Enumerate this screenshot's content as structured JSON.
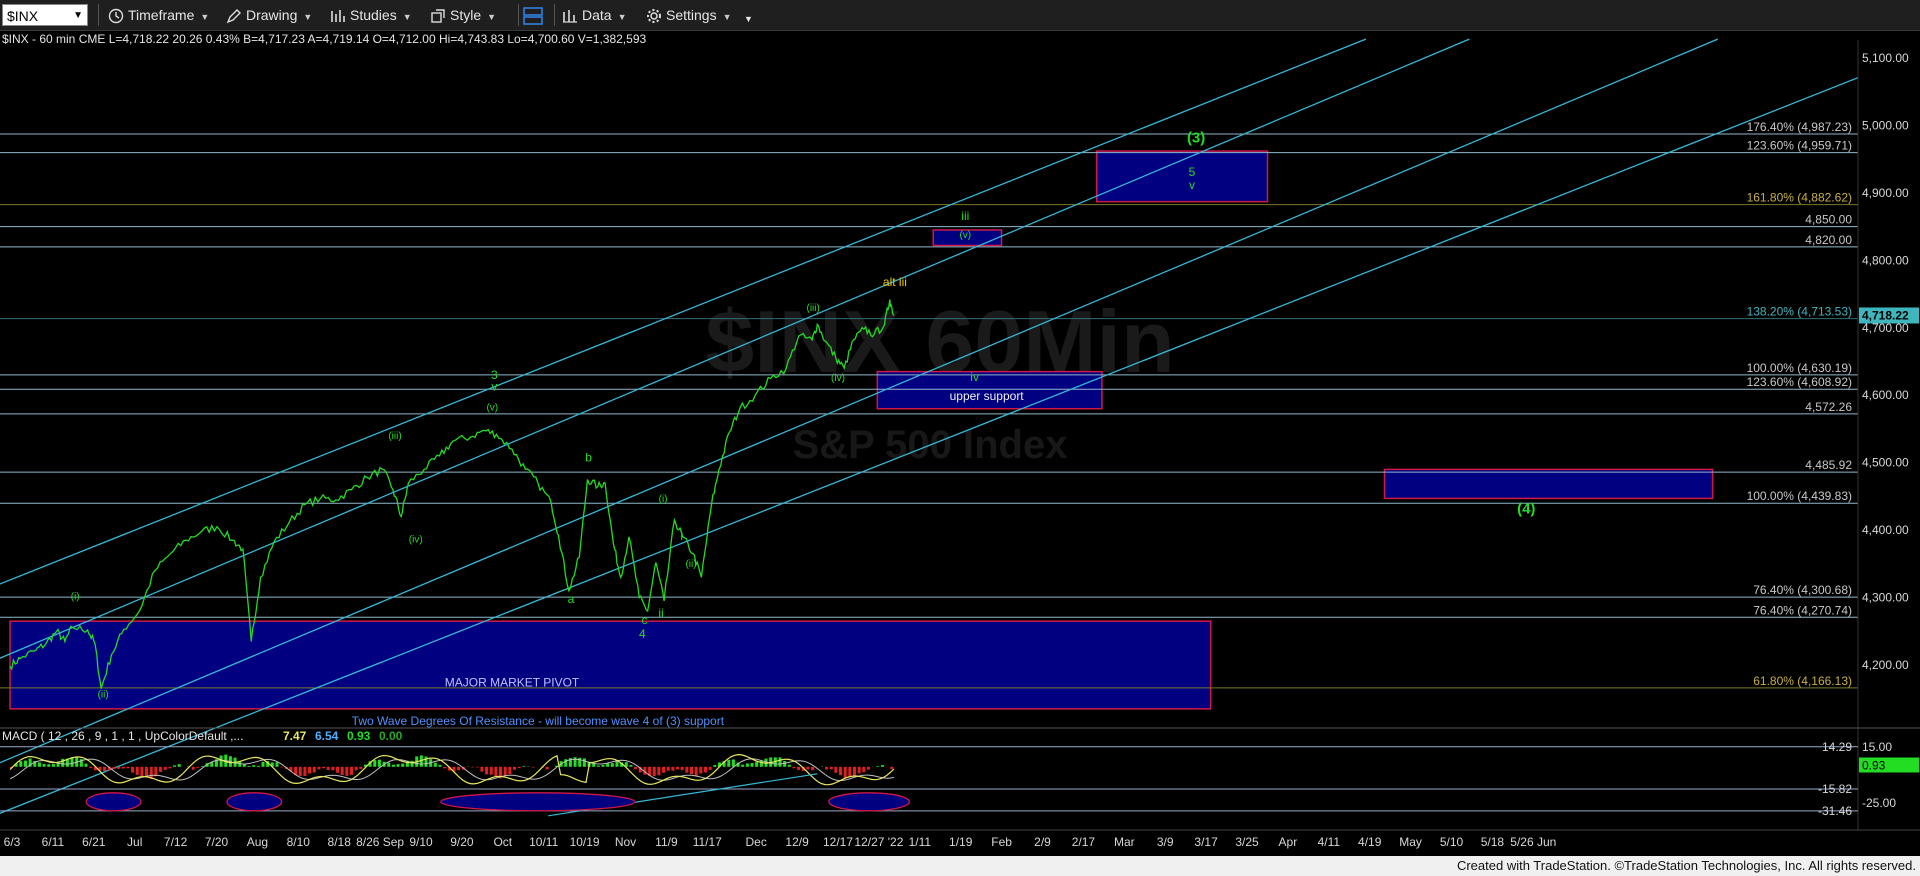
{
  "toolbar": {
    "symbol": "$INX",
    "timeframe": "Timeframe",
    "drawing": "Drawing",
    "studies": "Studies",
    "style": "Style",
    "data": "Data",
    "settings": "Settings"
  },
  "header": {
    "symbol_line": "$INX - 60 min  CME  L=4,718.22  20.26  0.43%  B=4,717.23  A=4,719.14  O=4,712.00  Hi=4,743.83  Lo=4,700.60  V=1,382,593"
  },
  "watermark": {
    "title": "$INX 60Min",
    "subtitle": "S&P 500 Index"
  },
  "colors": {
    "background": "#000000",
    "price": "#22dd22",
    "channel": "#36b8d6",
    "level_line": "#8fb9cc",
    "box_fill": "#000080",
    "box_border": "#d01848",
    "label_fib": "#c8c8c8",
    "label_gold": "#c8b040",
    "label_teal": "#3fb5bd",
    "macd_line": "#e8e860",
    "macd_signal": "#c0c0c0",
    "hist_up": "#22dd22",
    "hist_down": "#e02020"
  },
  "chart_data": {
    "type": "line",
    "ylim": [
      4100,
      5150
    ],
    "y_ticks": [
      "4,200.00",
      "4,300.00",
      "4,400.00",
      "4,500.00",
      "4,600.00",
      "4,700.00",
      "4,800.00",
      "4,900.00",
      "5,000.00",
      "5,100.00"
    ],
    "last_price": "4,718.22",
    "x_ticks": [
      "6/3",
      "6/11",
      "6/21",
      "Jul",
      "7/12",
      "7/20",
      "Aug",
      "8/10",
      "8/18",
      "8/26 Sep",
      "9/10",
      "9/20",
      "Oct",
      "10/11",
      "10/19",
      "Nov",
      "11/9",
      "11/17",
      "Dec",
      "12/9",
      "12/17",
      "12/27 '22",
      "1/11",
      "1/19",
      "Feb",
      "2/9",
      "2/17",
      "Mar",
      "3/9",
      "3/17",
      "3/25",
      "Apr",
      "4/11",
      "4/19",
      "May",
      "5/10",
      "5/18",
      "5/26 Jun"
    ],
    "price_path": [
      {
        "t": 0,
        "y": 4198
      },
      {
        "t": 1,
        "y": 4210
      },
      {
        "t": 2.5,
        "y": 4222
      },
      {
        "t": 3.5,
        "y": 4232
      },
      {
        "t": 4.5,
        "y": 4250
      },
      {
        "t": 5.3,
        "y": 4235
      },
      {
        "t": 6,
        "y": 4256
      },
      {
        "t": 7.5,
        "y": 4252
      },
      {
        "t": 8.2,
        "y": 4232
      },
      {
        "t": 8.8,
        "y": 4165
      },
      {
        "t": 9.8,
        "y": 4215
      },
      {
        "t": 11,
        "y": 4253
      },
      {
        "t": 12.5,
        "y": 4280
      },
      {
        "t": 14,
        "y": 4340
      },
      {
        "t": 15.5,
        "y": 4365
      },
      {
        "t": 17,
        "y": 4385
      },
      {
        "t": 18.5,
        "y": 4398
      },
      {
        "t": 20,
        "y": 4405
      },
      {
        "t": 21.5,
        "y": 4385
      },
      {
        "t": 22.5,
        "y": 4372
      },
      {
        "t": 23.3,
        "y": 4235
      },
      {
        "t": 24.2,
        "y": 4330
      },
      {
        "t": 25.5,
        "y": 4382
      },
      {
        "t": 27,
        "y": 4412
      },
      {
        "t": 28.5,
        "y": 4438
      },
      {
        "t": 30,
        "y": 4447
      },
      {
        "t": 31.5,
        "y": 4445
      },
      {
        "t": 33,
        "y": 4460
      },
      {
        "t": 34.5,
        "y": 4478
      },
      {
        "t": 36,
        "y": 4490
      },
      {
        "t": 37,
        "y": 4460
      },
      {
        "t": 37.8,
        "y": 4420
      },
      {
        "t": 38.5,
        "y": 4470
      },
      {
        "t": 40,
        "y": 4490
      },
      {
        "t": 41.5,
        "y": 4510
      },
      {
        "t": 42.8,
        "y": 4532
      },
      {
        "t": 44.5,
        "y": 4538
      },
      {
        "t": 45.8,
        "y": 4548
      },
      {
        "t": 47,
        "y": 4542
      },
      {
        "t": 48.5,
        "y": 4520
      },
      {
        "t": 49.8,
        "y": 4490
      },
      {
        "t": 51,
        "y": 4470
      },
      {
        "t": 52.3,
        "y": 4440
      },
      {
        "t": 53,
        "y": 4392
      },
      {
        "t": 54,
        "y": 4310
      },
      {
        "t": 55,
        "y": 4360
      },
      {
        "t": 55.8,
        "y": 4475
      },
      {
        "t": 56.8,
        "y": 4465
      },
      {
        "t": 57.5,
        "y": 4470
      },
      {
        "t": 58.3,
        "y": 4380
      },
      {
        "t": 59,
        "y": 4330
      },
      {
        "t": 59.8,
        "y": 4390
      },
      {
        "t": 60.8,
        "y": 4300
      },
      {
        "t": 61.6,
        "y": 4280
      },
      {
        "t": 62.4,
        "y": 4352
      },
      {
        "t": 63.2,
        "y": 4295
      },
      {
        "t": 64.2,
        "y": 4415
      },
      {
        "t": 65,
        "y": 4390
      },
      {
        "t": 66,
        "y": 4365
      },
      {
        "t": 66.8,
        "y": 4330
      },
      {
        "t": 67.8,
        "y": 4440
      },
      {
        "t": 68.5,
        "y": 4490
      },
      {
        "t": 69.5,
        "y": 4545
      },
      {
        "t": 70.5,
        "y": 4580
      },
      {
        "t": 72,
        "y": 4600
      },
      {
        "t": 73.5,
        "y": 4625
      },
      {
        "t": 75,
        "y": 4640
      },
      {
        "t": 76.2,
        "y": 4688
      },
      {
        "t": 77.5,
        "y": 4682
      },
      {
        "t": 78,
        "y": 4705
      },
      {
        "t": 78.8,
        "y": 4680
      },
      {
        "t": 79.8,
        "y": 4655
      },
      {
        "t": 80.6,
        "y": 4640
      },
      {
        "t": 81.5,
        "y": 4682
      },
      {
        "t": 82.5,
        "y": 4698
      },
      {
        "t": 83.5,
        "y": 4690
      },
      {
        "t": 84.5,
        "y": 4705
      },
      {
        "t": 85,
        "y": 4742
      },
      {
        "t": 85.4,
        "y": 4718
      }
    ],
    "channel_lines": [
      {
        "t1": -1,
        "y1": 4320,
        "t2": 131,
        "y2": 5128
      },
      {
        "t1": -1,
        "y1": 4210,
        "t2": 141,
        "y2": 5128
      },
      {
        "t1": -1,
        "y1": 4055,
        "t2": 165,
        "y2": 5128
      },
      {
        "t1": -1,
        "y1": 3980,
        "t2": 185,
        "y2": 5110
      }
    ],
    "horizontal_levels": [
      {
        "y": 4987.23,
        "label": "176.40% (4,987.23)",
        "color": "fib"
      },
      {
        "y": 4959.71,
        "label": "123.60% (4,959.71)",
        "color": "fib"
      },
      {
        "y": 4882.62,
        "label": "161.80% (4,882.62)",
        "color": "gold"
      },
      {
        "y": 4850.0,
        "label": "4,850.00",
        "color": "fib"
      },
      {
        "y": 4820.0,
        "label": "4,820.00",
        "color": "fib"
      },
      {
        "y": 4713.53,
        "label": "138.20% (4,713.53)",
        "color": "teal"
      },
      {
        "y": 4630.19,
        "label": "100.00% (4,630.19)",
        "color": "fib"
      },
      {
        "y": 4608.92,
        "label": "123.60% (4,608.92)",
        "color": "fib"
      },
      {
        "y": 4572.26,
        "label": "4,572.26",
        "color": "fib"
      },
      {
        "y": 4485.92,
        "label": "4,485.92",
        "color": "fib"
      },
      {
        "y": 4439.83,
        "label": "100.00% (4,439.83)",
        "color": "fib"
      },
      {
        "y": 4300.68,
        "label": "76.40% (4,300.68)",
        "color": "fib"
      },
      {
        "y": 4270.74,
        "label": "76.40% (4,270.74)",
        "color": "fib"
      },
      {
        "y": 4166.13,
        "label": "61.80% (4,166.13)",
        "color": "gold"
      }
    ],
    "boxes": [
      {
        "t1": 105,
        "t2": 121.5,
        "y1": 4887,
        "y2": 4962,
        "label": ""
      },
      {
        "t1": 89.2,
        "t2": 95.8,
        "y1": 4822,
        "y2": 4845,
        "label": ""
      },
      {
        "t1": 83.8,
        "t2": 105.5,
        "y1": 4580,
        "y2": 4635,
        "label": "upper support"
      },
      {
        "t1": 132.8,
        "t2": 164.5,
        "y1": 4447,
        "y2": 4490,
        "label": ""
      },
      {
        "t1": 0,
        "t2": 116,
        "y1": 4135,
        "y2": 4265,
        "label": "MAJOR MARKET PIVOT"
      }
    ],
    "annotations": [
      {
        "t": 114.6,
        "y": 4975,
        "text": "(3)",
        "color": "#22dd22",
        "size": 15,
        "bold": true
      },
      {
        "t": 114.2,
        "y": 4925,
        "text": "5",
        "color": "#22dd22",
        "size": 12
      },
      {
        "t": 114.2,
        "y": 4906,
        "text": "v",
        "color": "#22dd22",
        "size": 12
      },
      {
        "t": 92.3,
        "y": 4860,
        "text": "iii",
        "color": "#22dd22",
        "size": 12
      },
      {
        "t": 92.3,
        "y": 4833,
        "text": "(v)",
        "color": "#22dd22",
        "size": 10
      },
      {
        "t": 85.5,
        "y": 4762,
        "text": "alt iii",
        "color": "#e8c800",
        "size": 12
      },
      {
        "t": 77.6,
        "y": 4725,
        "text": "(iii)",
        "color": "#22dd22",
        "size": 10
      },
      {
        "t": 80,
        "y": 4621,
        "text": "(iv)",
        "color": "#22dd22",
        "size": 10
      },
      {
        "t": 93.2,
        "y": 4621,
        "text": "iv",
        "color": "#22dd22",
        "size": 12
      },
      {
        "t": 146.5,
        "y": 4425,
        "text": "(4)",
        "color": "#22dd22",
        "size": 15,
        "bold": true
      },
      {
        "t": 46.8,
        "y": 4624,
        "text": "3",
        "color": "#22dd22",
        "size": 12
      },
      {
        "t": 46.8,
        "y": 4607,
        "text": "v",
        "color": "#22dd22",
        "size": 12
      },
      {
        "t": 46.6,
        "y": 4577,
        "text": "(v)",
        "color": "#22dd22",
        "size": 10
      },
      {
        "t": 37.2,
        "y": 4535,
        "text": "(iii)",
        "color": "#22dd22",
        "size": 10
      },
      {
        "t": 39.2,
        "y": 4382,
        "text": "(iv)",
        "color": "#22dd22",
        "size": 10
      },
      {
        "t": 55.9,
        "y": 4502,
        "text": "b",
        "color": "#22dd22",
        "size": 12
      },
      {
        "t": 54.2,
        "y": 4292,
        "text": "a",
        "color": "#22dd22",
        "size": 12
      },
      {
        "t": 63.1,
        "y": 4442,
        "text": "(i)",
        "color": "#22dd22",
        "size": 10
      },
      {
        "t": 64.9,
        "y": 4385,
        "text": "i",
        "color": "#22dd22",
        "size": 12
      },
      {
        "t": 65.8,
        "y": 4345,
        "text": "(ii)",
        "color": "#22dd22",
        "size": 10
      },
      {
        "t": 61.3,
        "y": 4261,
        "text": "c",
        "color": "#22dd22",
        "size": 12
      },
      {
        "t": 62.9,
        "y": 4271,
        "text": "ii",
        "color": "#22dd22",
        "size": 12
      },
      {
        "t": 61.1,
        "y": 4240,
        "text": "4",
        "color": "#22dd22",
        "size": 12
      },
      {
        "t": 6.3,
        "y": 4297,
        "text": "(i)",
        "color": "#22dd22",
        "size": 10
      },
      {
        "t": 9,
        "y": 4152,
        "text": "(ii)",
        "color": "#22dd22",
        "size": 10
      },
      {
        "t": 51,
        "y": 4111,
        "text": "Two Wave Degrees Of Resistance - will become wave 4 of (3) support",
        "color": "#5090ff",
        "size": 12
      }
    ],
    "macd": {
      "title": "MACD ( 12 , 26 , 9 , 1 , 1 , UpColorDefault ,...",
      "values": [
        "7.47",
        "6.54",
        "0.93",
        "0.00"
      ],
      "ylim": [
        -38,
        22
      ],
      "axis_labels": [
        {
          "v": 14.29,
          "text": "14.29"
        },
        {
          "v": 15,
          "text": "15.00"
        },
        {
          "v": -15.82,
          "text": "-15.82"
        },
        {
          "v": -25,
          "text": "-25.00"
        },
        {
          "v": -31.46,
          "text": "-31.46"
        }
      ],
      "last": "0.93",
      "levels": [
        14.29,
        -15.82,
        -31.46
      ],
      "ellipses": [
        {
          "t": 10,
          "w": 4.5
        },
        {
          "t": 23.6,
          "w": 4.5
        },
        {
          "t": 51,
          "w": 18
        },
        {
          "t": 83,
          "w": 7
        }
      ]
    }
  },
  "footer": {
    "text": "Created with TradeStation. ©TradeStation Technologies, Inc. All rights reserved."
  }
}
